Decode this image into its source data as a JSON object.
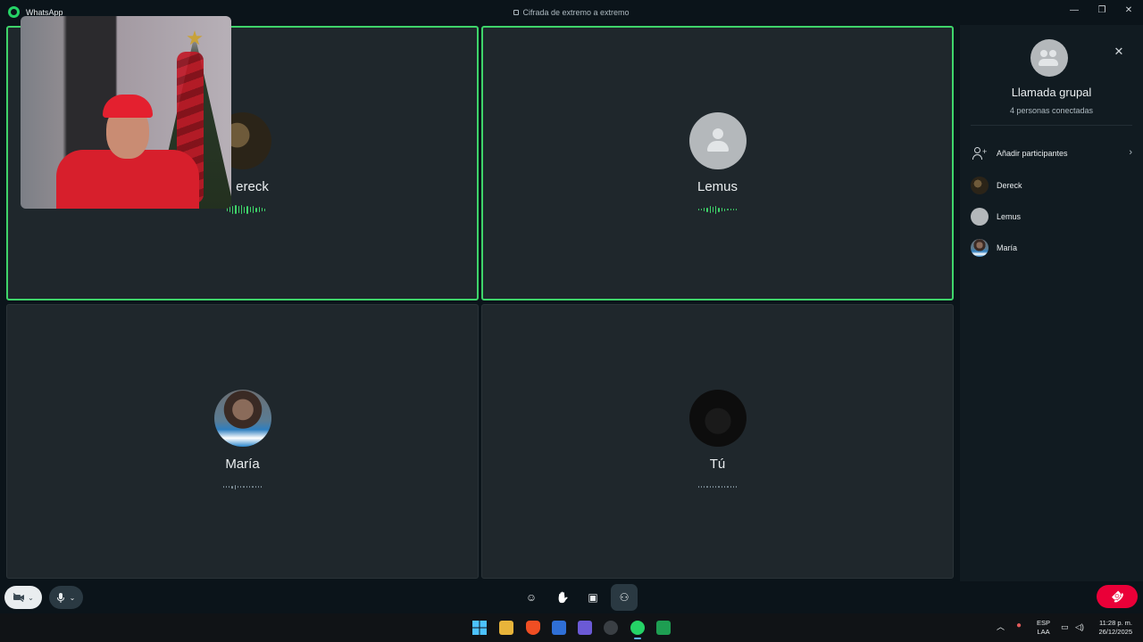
{
  "window": {
    "app_name": "WhatsApp",
    "encryption_notice": "Cifrada de extremo a extremo",
    "controls": {
      "minimize": "—",
      "restore": "❐",
      "close": "✕"
    }
  },
  "tiles": [
    {
      "name": "Dereck",
      "visible_name": "ereck",
      "speaking": true
    },
    {
      "name": "Lemus",
      "speaking": true
    },
    {
      "name": "María",
      "speaking": false
    },
    {
      "name": "Tú",
      "speaking": false
    }
  ],
  "panel": {
    "title": "Llamada grupal",
    "subtitle": "4 personas conectadas",
    "close_icon": "✕",
    "add_label": "Añadir participantes",
    "participants": [
      "Dereck",
      "Lemus",
      "María"
    ]
  },
  "controls": {
    "camera_icon": "camera-off-icon",
    "mic_icon": "microphone-icon",
    "emoji_icon": "☺",
    "raise_hand_icon": "✋",
    "share_icon": "▣",
    "participants_icon": "⚇",
    "end_call_icon": "☎"
  },
  "taskbar": {
    "language_line1": "ESP",
    "language_line2": "LAA",
    "time": "11:28 p. m.",
    "date": "26/12/2025"
  },
  "colors": {
    "speaking_border": "#3fd46a",
    "end_call": "#ea0038",
    "accent": "#25d366"
  }
}
